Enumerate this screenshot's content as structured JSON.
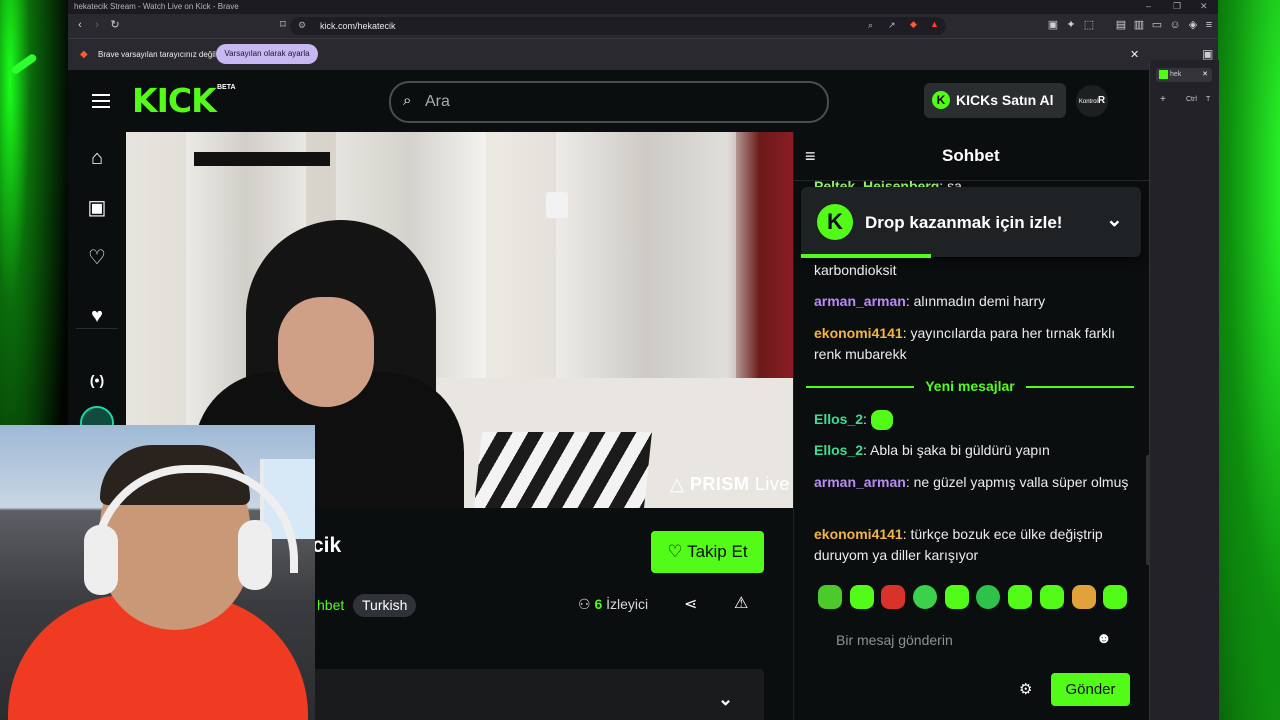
{
  "browser": {
    "window_title": "hekatecik Stream - Watch Live on Kick - Brave",
    "url": "kick.com/hekatecik",
    "infobar_text": "Brave varsayılan tarayıcınız değil",
    "infobar_button": "Varsayılan olarak ayarla",
    "side_tab_label": "hek",
    "side_shortcut_1": "Ctrl",
    "side_shortcut_2": "T"
  },
  "header": {
    "logo": "KICK",
    "logo_badge": "BETA",
    "search_placeholder": "Ara",
    "buy_kicks": "KICKs Satın Al",
    "avatar_text": "R",
    "avatar_small": "Kontrol"
  },
  "video": {
    "overlay_brand": "PRISM",
    "overlay_brand_suffix": "Live"
  },
  "channel": {
    "name_visible": "cik",
    "follow_label": "Takip Et",
    "tags": [
      "hbet",
      "Turkish"
    ],
    "viewers_count": "6",
    "viewers_label": "İzleyici"
  },
  "chat": {
    "title": "Sohbet",
    "drop_banner": "Drop kazanmak için izle!",
    "new_messages_label": "Yeni mesajlar",
    "input_placeholder": "Bir mesaj gönderin",
    "send_label": "Gönder",
    "messages": [
      {
        "user": "Peltek_Heisenberg",
        "text": "sa",
        "color": "#93f56a"
      },
      {
        "user": "",
        "text": "karbondioksit",
        "color": "#ececec"
      },
      {
        "user": "arman_arman",
        "text": "alınmadın demi harry",
        "color": "#b98cf5"
      },
      {
        "user": "ekonomi4141",
        "text": "yayıncılarda para her tırnak farklı renk mubarekk",
        "color": "#f5b342"
      },
      {
        "user": "Ellos_2",
        "text": "",
        "color": "#3ddc97"
      },
      {
        "user": "Ellos_2",
        "text": "Abla bi şaka bi güldürü yapın",
        "color": "#3ddc97"
      },
      {
        "user": "arman_arman",
        "text": "ne güzel yapmış valla süper olmuş",
        "color": "#b98cf5"
      },
      {
        "user": "ekonomi4141",
        "text": "türkçe bozuk ece ülke değiştrip duruyom ya diller karışıyor",
        "color": "#f5b342"
      }
    ]
  },
  "colors": {
    "accent": "#53fc18",
    "background": "#0b0e0f"
  }
}
